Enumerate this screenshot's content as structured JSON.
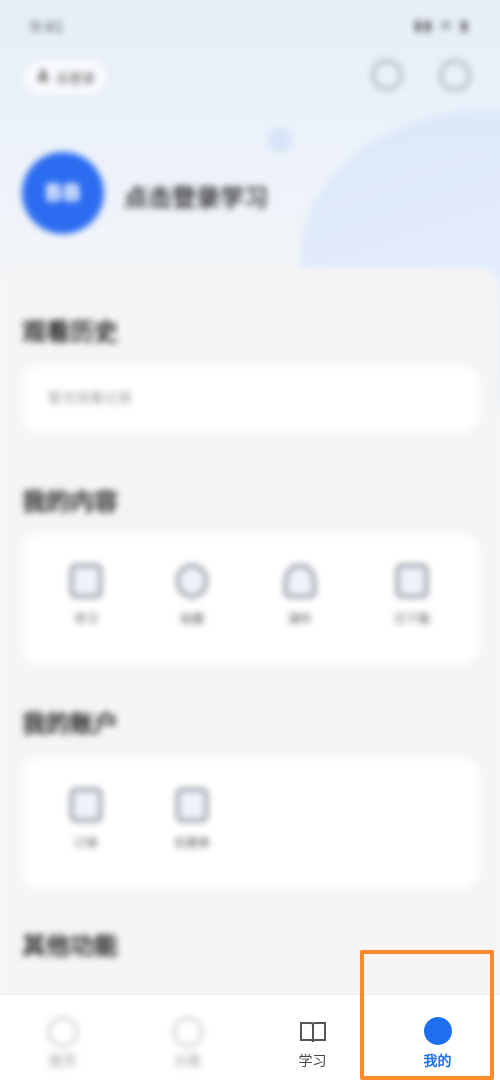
{
  "status_bar": {
    "time": "9:41",
    "icons": "▮▮ ≋ ▮"
  },
  "header": {
    "login_label": "去登录",
    "settings_icon": "gear-icon",
    "message_icon": "message-icon"
  },
  "profile": {
    "avatar_text": "BB",
    "name": "点击登录学习"
  },
  "sections": {
    "history_title": "观看历史",
    "history_placeholder": "暂无观看记录",
    "content_title": "我的内容",
    "content_items": [
      {
        "label": "学习",
        "icon": "calendar-icon"
      },
      {
        "label": "收藏",
        "icon": "star-icon"
      },
      {
        "label": "课件",
        "icon": "cloud-icon"
      },
      {
        "label": "已下载",
        "icon": "document-icon"
      }
    ],
    "account_title": "我的账户",
    "account_items": [
      {
        "label": "订单",
        "icon": "order-icon"
      },
      {
        "label": "优惠券",
        "icon": "coupon-icon"
      }
    ],
    "other_title": "其他功能"
  },
  "bottom_nav": [
    {
      "label": "首页",
      "icon": "home-icon"
    },
    {
      "label": "分类",
      "icon": "category-icon"
    },
    {
      "label": "学习",
      "icon": "book-icon"
    },
    {
      "label": "我的",
      "icon": "user-icon"
    }
  ],
  "colors": {
    "accent": "#1e6ff0",
    "highlight": "#ff8a2b"
  }
}
